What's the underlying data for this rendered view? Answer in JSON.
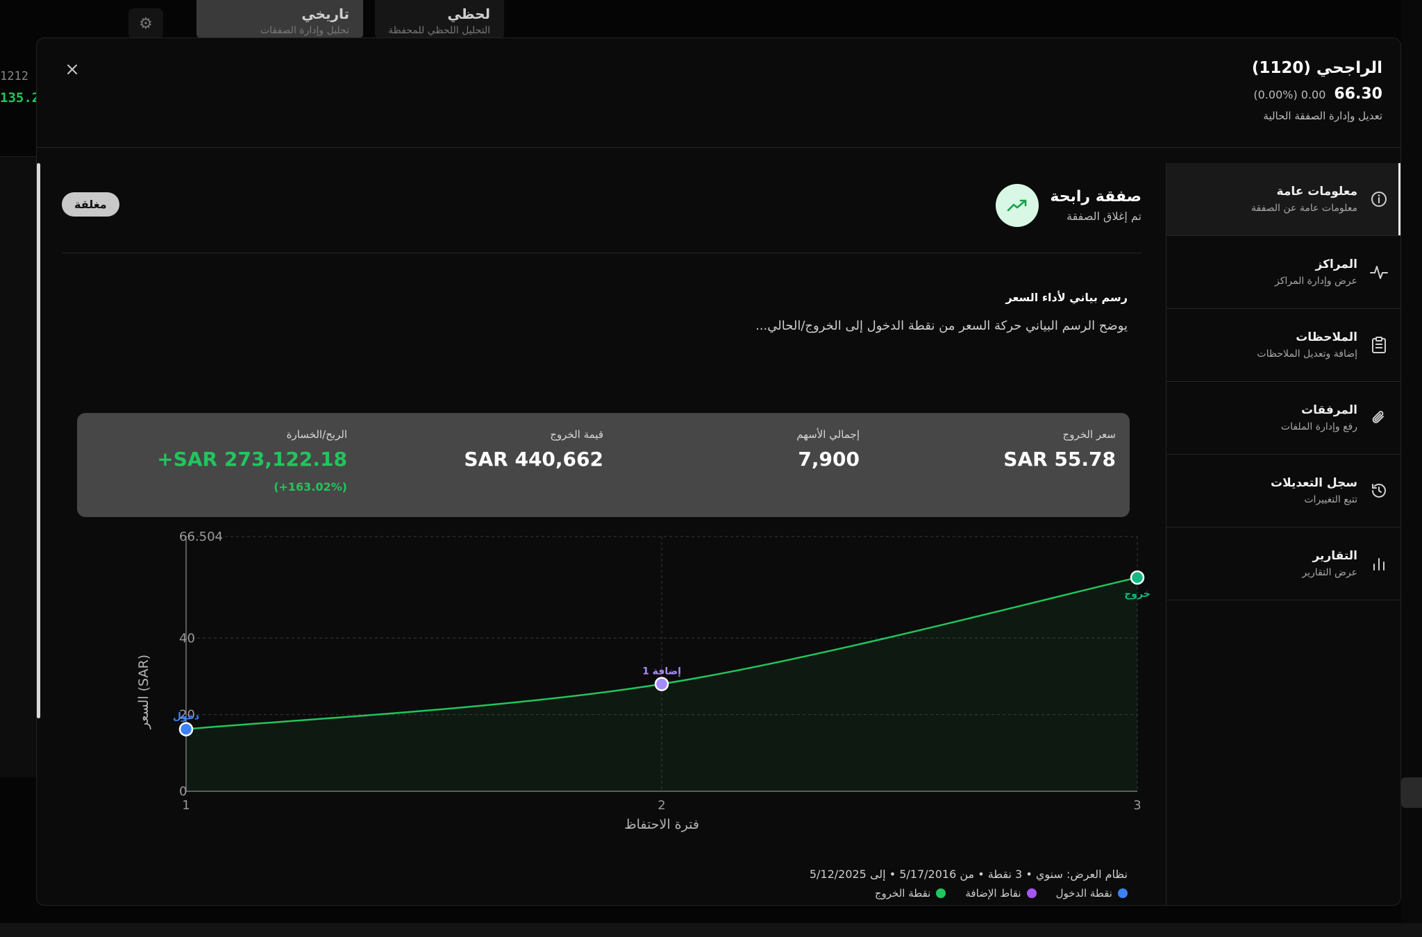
{
  "background": {
    "tab_history": {
      "title": "تاريخي",
      "sub": "تحليل وإدارة الصفقات"
    },
    "tab_live": {
      "title": "لحظي",
      "sub": "التحليل اللحظي للمحفظة"
    },
    "num1": "1212",
    "num2": "135.2"
  },
  "header": {
    "title": "الراجحي (1120)",
    "price": "66.30",
    "change": "(0.00%) 0.00",
    "subtitle": "تعديل وإدارة الصفقة الحالية"
  },
  "nav": {
    "items": [
      {
        "label": "معلومات عامة",
        "desc": "معلومات عامة عن الصفقة"
      },
      {
        "label": "المراكز",
        "desc": "عرض وإدارة المراكز"
      },
      {
        "label": "الملاحظات",
        "desc": "إضافة وتعديل الملاحظات"
      },
      {
        "label": "المرفقات",
        "desc": "رفع وإدارة الملفات"
      },
      {
        "label": "سجل التعديلات",
        "desc": "تتبع التغييرات"
      },
      {
        "label": "التقارير",
        "desc": "عرض التقارير"
      }
    ]
  },
  "deal": {
    "title": "صفقة رابحة",
    "subtitle": "تم إغلاق الصفقة",
    "status": "مغلقة"
  },
  "section": {
    "title": "رسم بياني لأداء السعر",
    "desc": "يوضح الرسم البياني حركة السعر من نقطة الدخول إلى الخروج/الحالي..."
  },
  "stats": {
    "exit_price": {
      "label": "سعر الخروج",
      "value": "SAR 55.78"
    },
    "total_shares": {
      "label": "إجمالي الأسهم",
      "value": "7,900"
    },
    "exit_value": {
      "label": "قيمة الخروج",
      "value": "SAR 440,662"
    },
    "pnl": {
      "label": "الربح/الخسارة",
      "value": "+SAR 273,122.18",
      "pct": "(+163.02%)"
    }
  },
  "chart_data": {
    "type": "line",
    "x": [
      1,
      2,
      3
    ],
    "xlim": [
      1,
      3
    ],
    "ylim": [
      0,
      66.504
    ],
    "yticks": [
      "0",
      "20",
      "40",
      "66.504"
    ],
    "xticks": [
      "1",
      "2",
      "3"
    ],
    "xlabel": "فترة الاحتفاظ",
    "ylabel": "السعر (SAR)",
    "grid": true,
    "series": [
      {
        "values": [
          16.2,
          28,
          55.78
        ]
      }
    ],
    "points": [
      {
        "x": 1,
        "y": 16.2,
        "label": "دخول",
        "color": "#3b82f6"
      },
      {
        "x": 2,
        "y": 28,
        "label": "إضافة 1",
        "color": "#a78bfa"
      },
      {
        "x": 3,
        "y": 55.78,
        "label": "خروج",
        "color": "#10b981"
      }
    ],
    "line_color": "#22c55e"
  },
  "footer": {
    "summary": "نظام العرض: سنوي  •  3 نقطة  •  من 5/17/2016  •  إلى 5/12/2025",
    "legend": [
      {
        "label": "نقطة الدخول",
        "color": "#3b82f6"
      },
      {
        "label": "نقاط الإضافة",
        "color": "#a855f7"
      },
      {
        "label": "نقطة الخروج",
        "color": "#22c55e"
      }
    ]
  }
}
